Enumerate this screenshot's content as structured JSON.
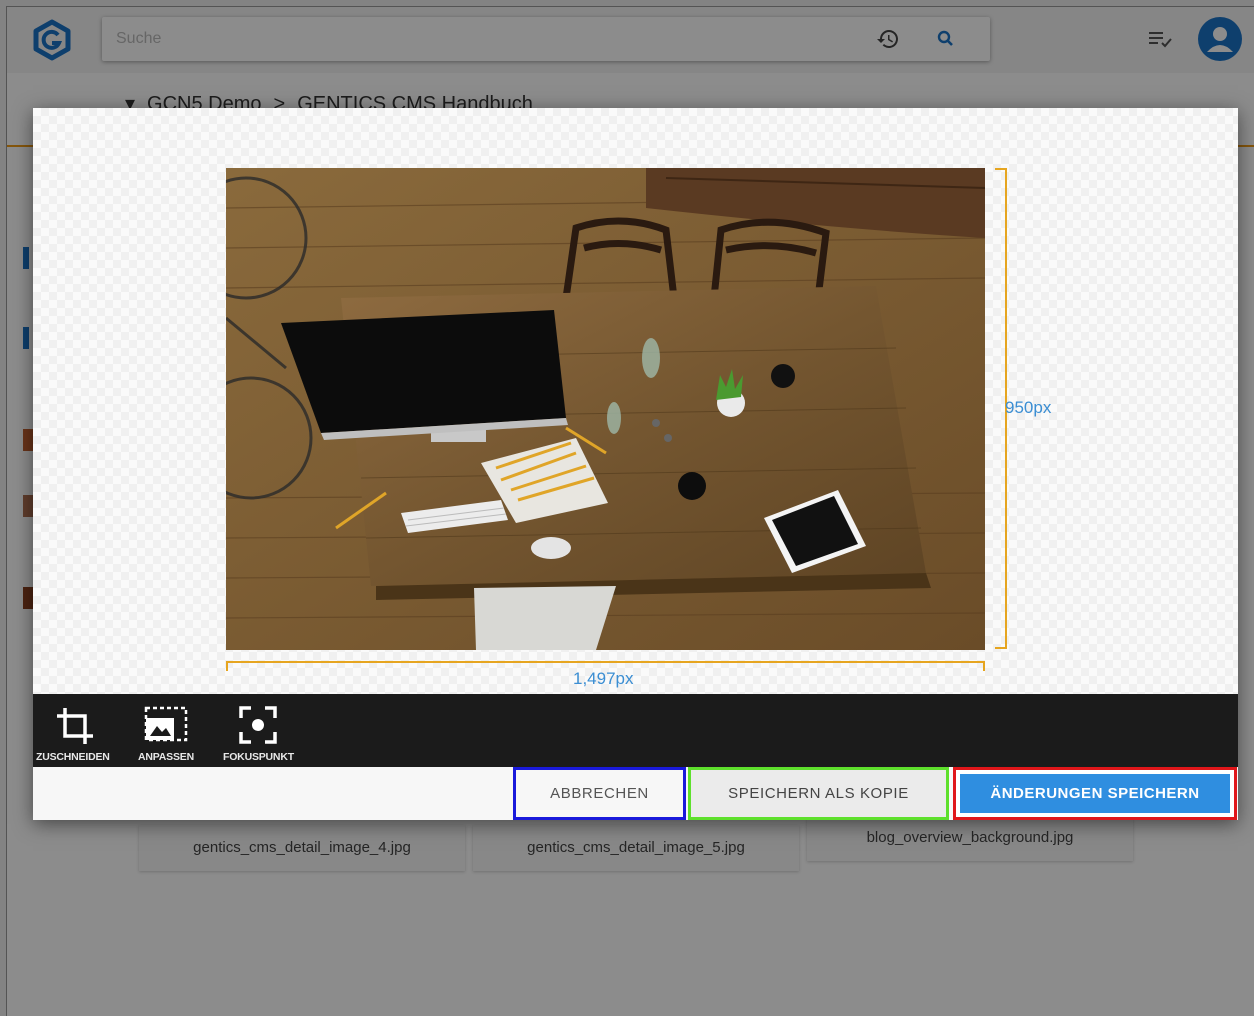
{
  "search": {
    "placeholder": "Suche"
  },
  "breadcrumb": {
    "root": "GCN5 Demo",
    "separator": ">",
    "current": "GENTICS CMS Handbuch"
  },
  "background_files": [
    {
      "name": "gentics_cms_detail_image_4.jpg"
    },
    {
      "name": "gentics_cms_detail_image_5.jpg"
    },
    {
      "name": "blog_overview_background.jpg"
    }
  ],
  "image_editor": {
    "image_subject": "desk-photo",
    "height_label": "950px",
    "width_label": "1,497px",
    "tools": [
      {
        "label": "ZUSCHNEIDEN",
        "icon": "crop-icon"
      },
      {
        "label": "ANPASSEN",
        "icon": "resize-icon"
      },
      {
        "label": "FOKUSPUNKT",
        "icon": "focal-point-icon"
      }
    ],
    "buttons": {
      "cancel": "ABBRECHEN",
      "save_copy": "SPEICHERN ALS KOPIE",
      "save": "ÄNDERUNGEN SPEICHERN"
    }
  },
  "colors": {
    "accent_blue": "#2f8ee0",
    "dimension_orange": "#e6a520",
    "highlight_cancel": "#1a1adb",
    "highlight_copy": "#5ee02c",
    "highlight_save": "#e0161a"
  }
}
